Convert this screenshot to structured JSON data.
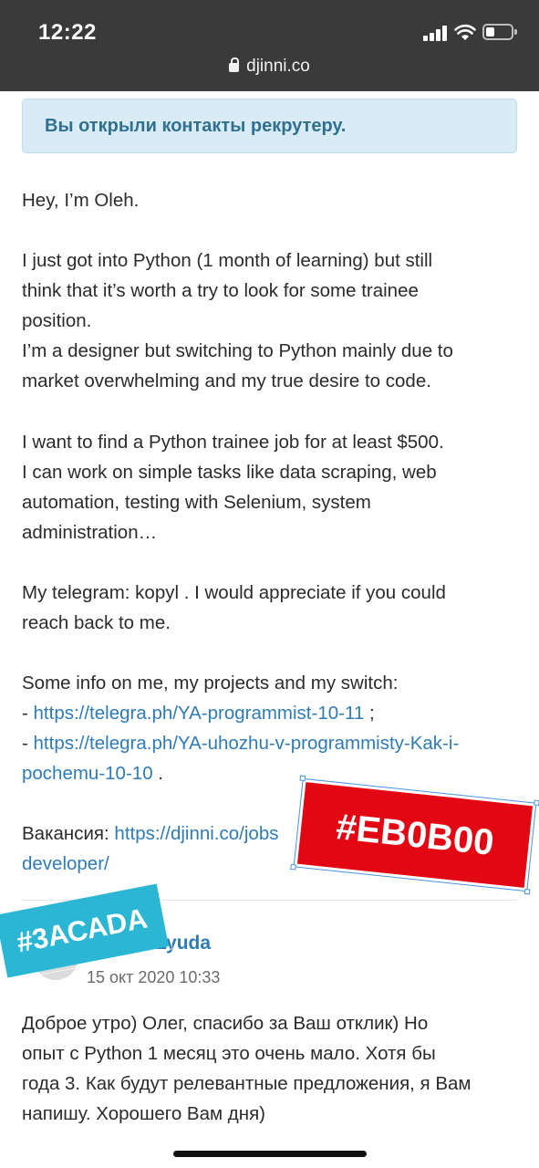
{
  "status_bar": {
    "time": "12:22"
  },
  "browser": {
    "domain": "djinni.co"
  },
  "alert": {
    "text": "Вы открыли контакты рекрутеру."
  },
  "message": {
    "greeting": "Hey, I’m Oleh.",
    "p1": [
      "I just got into Python (1 month of learning) but still",
      "think that it’s worth a try to look for some trainee",
      "position.",
      "I’m a designer but switching to Python mainly due to",
      "market overwhelming and my true desire to code."
    ],
    "p2": [
      "I want to find a Python trainee job for at least $500.",
      "I can work on simple tasks like data scraping, web",
      "automation, testing with Selenium, system",
      "administration…"
    ],
    "p3": [
      "My telegram: kopyl . I would appreciate if you could",
      "reach back to me."
    ],
    "p4_intro": "Some info on me, my projects and my switch:",
    "link1": "https://telegra.ph/YA-programmist-10-11",
    "link1_suffix": " ;",
    "link2_line1": "https://telegra.ph/YA-uhozhu-v-programmisty-Kak-i-",
    "link2_line2": "pochemu-10-10",
    "link2_suffix": " .",
    "vacancy_label": "Вакансия: ",
    "vacancy_link_line1": "https://djinni.co/jobs",
    "vacancy_link_line2": "developer/",
    "dash": "- "
  },
  "reply": {
    "author": "Lyuda",
    "date": "15 окт 2020 10:33",
    "lines": [
      "Доброе утро) Олег, спасибо за Ваш отклик) Но",
      "опыт с Python 1 месяц это очень мало. Хотя бы",
      "года 3. Как будут релевантные предложения, я Вам",
      "напишу. Хорошего Вам дня)"
    ]
  },
  "stickers": {
    "red": "#ЕВ0В00",
    "teal": "#3АСАDА"
  },
  "colors": {
    "link": "#2f7bb5",
    "alert_bg": "#d9ecf5",
    "alert_text": "#31708f",
    "sticker_red": "#e30613",
    "sticker_teal": "#2bb7d4"
  }
}
